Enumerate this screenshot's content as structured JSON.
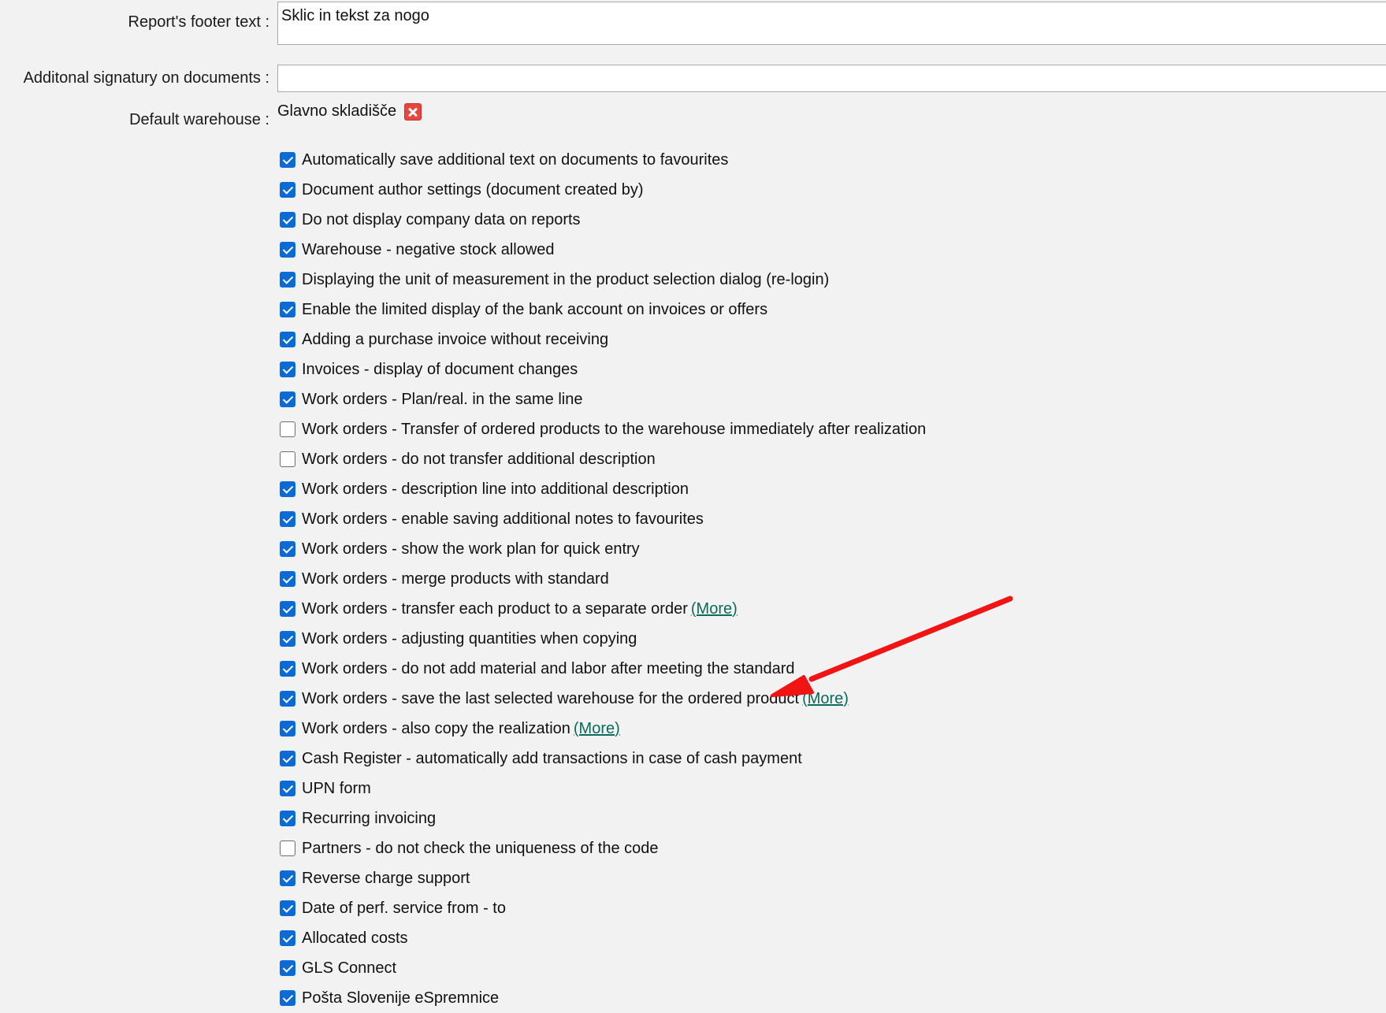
{
  "form": {
    "footer_label": "Report's footer text :",
    "footer_value": "Sklic in tekst za nogo",
    "signature_label": "Additonal signatury on documents :",
    "signature_value": "",
    "warehouse_label": "Default warehouse :",
    "warehouse_value": "Glavno skladišče",
    "warehouse_remove_icon": "remove-icon"
  },
  "options": [
    {
      "label": "Automatically save additional text on documents to favourites",
      "checked": true
    },
    {
      "label": "Document author settings (document created by)",
      "checked": true
    },
    {
      "label": "Do not display company data on reports",
      "checked": true
    },
    {
      "label": "Warehouse - negative stock allowed",
      "checked": true
    },
    {
      "label": "Displaying the unit of measurement in the product selection dialog (re-login)",
      "checked": true
    },
    {
      "label": "Enable the limited display of the bank account on invoices or offers",
      "checked": true
    },
    {
      "label": "Adding a purchase invoice without receiving",
      "checked": true
    },
    {
      "label": "Invoices - display of document changes",
      "checked": true
    },
    {
      "label": "Work orders - Plan/real. in the same line",
      "checked": true
    },
    {
      "label": "Work orders - Transfer of ordered products to the warehouse immediately after realization",
      "checked": false
    },
    {
      "label": "Work orders - do not transfer additional description",
      "checked": false
    },
    {
      "label": "Work orders - description line into additional description",
      "checked": true
    },
    {
      "label": "Work orders - enable saving additional notes to favourites",
      "checked": true
    },
    {
      "label": "Work orders - show the work plan for quick entry",
      "checked": true
    },
    {
      "label": "Work orders - merge products with standard",
      "checked": true
    },
    {
      "label": "Work orders - transfer each product to a separate order",
      "checked": true,
      "more": "(More)"
    },
    {
      "label": "Work orders - adjusting quantities when copying",
      "checked": true
    },
    {
      "label": "Work orders - do not add material and labor after meeting the standard",
      "checked": true
    },
    {
      "label": "Work orders - save the last selected warehouse for the ordered product",
      "checked": true,
      "more": "(More)"
    },
    {
      "label": "Work orders - also copy the realization",
      "checked": true,
      "more": "(More)"
    },
    {
      "label": "Cash Register - automatically add transactions in case of cash payment",
      "checked": true
    },
    {
      "label": "UPN form",
      "checked": true
    },
    {
      "label": "Recurring invoicing",
      "checked": true
    },
    {
      "label": "Partners - do not check the uniqueness of the code",
      "checked": false
    },
    {
      "label": "Reverse charge support",
      "checked": true
    },
    {
      "label": "Date of perf. service from - to",
      "checked": true
    },
    {
      "label": "Allocated costs",
      "checked": true
    },
    {
      "label": "GLS Connect",
      "checked": true
    },
    {
      "label": "Pošta Slovenije eSpremnice",
      "checked": true
    }
  ],
  "colors": {
    "checkbox_checked": "#0b6bd6",
    "link": "#0b6b5a",
    "annotation_arrow": "#f01414"
  }
}
